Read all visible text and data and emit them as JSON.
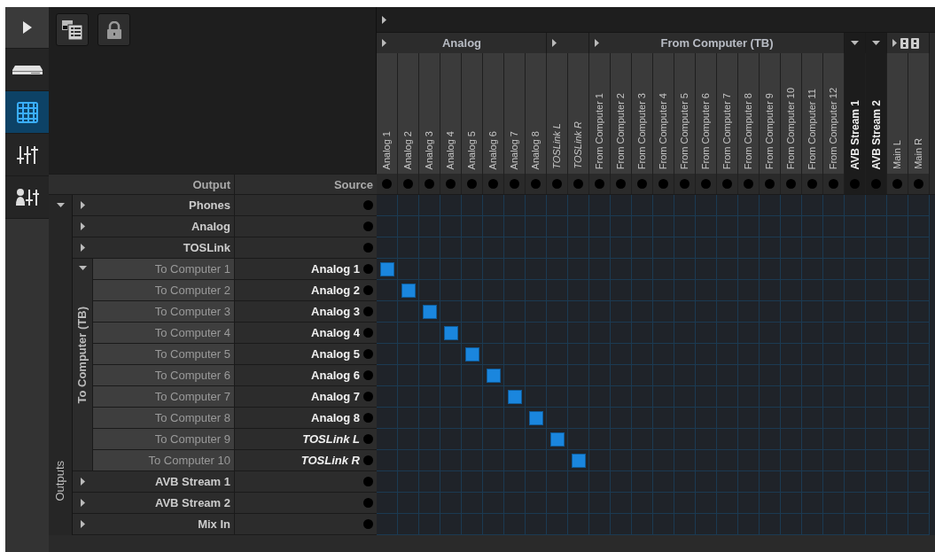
{
  "sidebar": {
    "items": [
      {
        "kind": "expand",
        "selected": false
      },
      {
        "kind": "device",
        "selected": false
      },
      {
        "kind": "matrix",
        "selected": true
      },
      {
        "kind": "mixer",
        "selected": false
      },
      {
        "kind": "user-mixer",
        "selected": false
      }
    ]
  },
  "headers": {
    "output": "Output",
    "source": "Source"
  },
  "sources": {
    "expanded": false,
    "groups": [
      {
        "kind": "group",
        "label": "Analog",
        "expanded": false,
        "channels": [
          {
            "name": "Analog 1",
            "italic": false
          },
          {
            "name": "Analog 2",
            "italic": false
          },
          {
            "name": "Analog 3",
            "italic": false
          },
          {
            "name": "Analog 4",
            "italic": false
          },
          {
            "name": "Analog 5",
            "italic": false
          },
          {
            "name": "Analog 6",
            "italic": false
          },
          {
            "name": "Analog 7",
            "italic": false
          },
          {
            "name": "Analog 8",
            "italic": false
          }
        ]
      },
      {
        "kind": "group",
        "expanded": false,
        "channels": [
          {
            "name": "TOSLink L",
            "italic": true
          },
          {
            "name": "TOSLink R",
            "italic": true
          }
        ]
      },
      {
        "kind": "group",
        "label": "From Computer (TB)",
        "expanded": false,
        "channels": [
          {
            "name": "From Computer 1",
            "italic": false
          },
          {
            "name": "From Computer 2",
            "italic": false
          },
          {
            "name": "From Computer 3",
            "italic": false
          },
          {
            "name": "From Computer 4",
            "italic": false
          },
          {
            "name": "From Computer 5",
            "italic": false
          },
          {
            "name": "From Computer 6",
            "italic": false
          },
          {
            "name": "From Computer 7",
            "italic": false
          },
          {
            "name": "From Computer 8",
            "italic": false
          },
          {
            "name": "From Computer 9",
            "italic": false
          },
          {
            "name": "From Computer 10",
            "italic": false
          },
          {
            "name": "From Computer 11",
            "italic": false
          },
          {
            "name": "From Computer 12",
            "italic": false
          }
        ]
      },
      {
        "kind": "stream",
        "expanded": true,
        "channels": [
          {
            "name": "AVB Stream 1",
            "italic": false
          }
        ]
      },
      {
        "kind": "stream",
        "expanded": true,
        "channels": [
          {
            "name": "AVB Stream 2",
            "italic": false
          }
        ]
      },
      {
        "kind": "main",
        "expanded": false,
        "channels": [
          {
            "name": "Main L",
            "italic": false
          },
          {
            "name": "Main R",
            "italic": false
          }
        ]
      }
    ]
  },
  "outputs": {
    "label": "Outputs",
    "expanded": true,
    "groups": [
      {
        "name": "Phones",
        "expanded": false,
        "connected": [
          false,
          false,
          false,
          false,
          false,
          false,
          false,
          false,
          false,
          false,
          false,
          false,
          false,
          false,
          false,
          false,
          false,
          false,
          false,
          false,
          false,
          false,
          false,
          false,
          false,
          false
        ]
      },
      {
        "name": "Analog",
        "expanded": false,
        "connected": [
          false,
          false,
          false,
          false,
          false,
          false,
          false,
          false,
          false,
          false,
          false,
          false,
          false,
          false,
          false,
          false,
          false,
          false,
          false,
          false,
          false,
          false,
          false,
          false,
          false,
          false
        ]
      },
      {
        "name": "TOSLink",
        "expanded": false,
        "connected": [
          false,
          false,
          false,
          false,
          false,
          false,
          false,
          false,
          false,
          false,
          false,
          false,
          false,
          false,
          false,
          false,
          false,
          false,
          false,
          false,
          false,
          false,
          false,
          false,
          false,
          false
        ]
      },
      {
        "name": "To Computer (TB)",
        "expanded": true,
        "children": [
          {
            "name": "To Computer 1",
            "source": "Analog 1",
            "source_italic": false,
            "connected": [
              true,
              false,
              false,
              false,
              false,
              false,
              false,
              false,
              false,
              false,
              false,
              false,
              false,
              false,
              false,
              false,
              false,
              false,
              false,
              false,
              false,
              false,
              false,
              false,
              false,
              false
            ]
          },
          {
            "name": "To Computer 2",
            "source": "Analog 2",
            "source_italic": false,
            "connected": [
              false,
              true,
              false,
              false,
              false,
              false,
              false,
              false,
              false,
              false,
              false,
              false,
              false,
              false,
              false,
              false,
              false,
              false,
              false,
              false,
              false,
              false,
              false,
              false,
              false,
              false
            ]
          },
          {
            "name": "To Computer 3",
            "source": "Analog 3",
            "source_italic": false,
            "connected": [
              false,
              false,
              true,
              false,
              false,
              false,
              false,
              false,
              false,
              false,
              false,
              false,
              false,
              false,
              false,
              false,
              false,
              false,
              false,
              false,
              false,
              false,
              false,
              false,
              false,
              false
            ]
          },
          {
            "name": "To Computer 4",
            "source": "Analog 4",
            "source_italic": false,
            "connected": [
              false,
              false,
              false,
              true,
              false,
              false,
              false,
              false,
              false,
              false,
              false,
              false,
              false,
              false,
              false,
              false,
              false,
              false,
              false,
              false,
              false,
              false,
              false,
              false,
              false,
              false
            ]
          },
          {
            "name": "To Computer 5",
            "source": "Analog 5",
            "source_italic": false,
            "connected": [
              false,
              false,
              false,
              false,
              true,
              false,
              false,
              false,
              false,
              false,
              false,
              false,
              false,
              false,
              false,
              false,
              false,
              false,
              false,
              false,
              false,
              false,
              false,
              false,
              false,
              false
            ]
          },
          {
            "name": "To Computer 6",
            "source": "Analog 6",
            "source_italic": false,
            "connected": [
              false,
              false,
              false,
              false,
              false,
              true,
              false,
              false,
              false,
              false,
              false,
              false,
              false,
              false,
              false,
              false,
              false,
              false,
              false,
              false,
              false,
              false,
              false,
              false,
              false,
              false
            ]
          },
          {
            "name": "To Computer 7",
            "source": "Analog 7",
            "source_italic": false,
            "connected": [
              false,
              false,
              false,
              false,
              false,
              false,
              true,
              false,
              false,
              false,
              false,
              false,
              false,
              false,
              false,
              false,
              false,
              false,
              false,
              false,
              false,
              false,
              false,
              false,
              false,
              false
            ]
          },
          {
            "name": "To Computer 8",
            "source": "Analog 8",
            "source_italic": false,
            "connected": [
              false,
              false,
              false,
              false,
              false,
              false,
              false,
              true,
              false,
              false,
              false,
              false,
              false,
              false,
              false,
              false,
              false,
              false,
              false,
              false,
              false,
              false,
              false,
              false,
              false,
              false
            ]
          },
          {
            "name": "To Computer 9",
            "source": "TOSLink L",
            "source_italic": true,
            "connected": [
              false,
              false,
              false,
              false,
              false,
              false,
              false,
              false,
              true,
              false,
              false,
              false,
              false,
              false,
              false,
              false,
              false,
              false,
              false,
              false,
              false,
              false,
              false,
              false,
              false,
              false
            ]
          },
          {
            "name": "To Computer 10",
            "source": "TOSLink R",
            "source_italic": true,
            "connected": [
              false,
              false,
              false,
              false,
              false,
              false,
              false,
              false,
              false,
              true,
              false,
              false,
              false,
              false,
              false,
              false,
              false,
              false,
              false,
              false,
              false,
              false,
              false,
              false,
              false,
              false
            ]
          }
        ]
      },
      {
        "name": "AVB Stream 1",
        "expanded": false,
        "connected": [
          false,
          false,
          false,
          false,
          false,
          false,
          false,
          false,
          false,
          false,
          false,
          false,
          false,
          false,
          false,
          false,
          false,
          false,
          false,
          false,
          false,
          false,
          false,
          false,
          false,
          false
        ]
      },
      {
        "name": "AVB Stream 2",
        "expanded": false,
        "connected": [
          false,
          false,
          false,
          false,
          false,
          false,
          false,
          false,
          false,
          false,
          false,
          false,
          false,
          false,
          false,
          false,
          false,
          false,
          false,
          false,
          false,
          false,
          false,
          false,
          false,
          false
        ]
      },
      {
        "name": "Mix In",
        "expanded": false,
        "connected": [
          false,
          false,
          false,
          false,
          false,
          false,
          false,
          false,
          false,
          false,
          false,
          false,
          false,
          false,
          false,
          false,
          false,
          false,
          false,
          false,
          false,
          false,
          false,
          false,
          false,
          false
        ]
      }
    ]
  }
}
